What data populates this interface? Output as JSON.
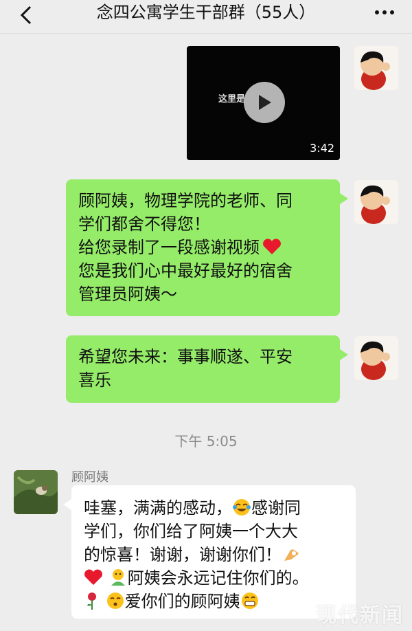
{
  "header": {
    "title": "念四公寓学生干部群（55人）"
  },
  "messages": {
    "video": {
      "duration": "3:42",
      "overlay_text": "这里是"
    },
    "msg1": {
      "line1": "顾阿姨，物理学院的老师、同",
      "line2": "学们都舍不得您！",
      "line3": "给您录制了一段感谢视频",
      "line4": "您是我们心中最好最好的宿舍",
      "line5": "管理员阿姨～"
    },
    "msg2": {
      "line1": "希望您未来：事事顺遂、平安",
      "line2": "喜乐"
    },
    "timestamp": "下午 5:05",
    "reply": {
      "sender": "顾阿姨",
      "line1a": "哇塞，满满的感动，",
      "line1b": "感谢同",
      "line2": "学们，你们给了阿姨一个大大",
      "line3": "的惊喜！谢谢，谢谢你们！",
      "line4": "阿姨会永远记住你们的。",
      "line5": "爱你们的顾阿姨"
    }
  },
  "watermark": "现代新闻",
  "colors": {
    "bubble_green": "#95ec69",
    "background": "#ededed"
  }
}
